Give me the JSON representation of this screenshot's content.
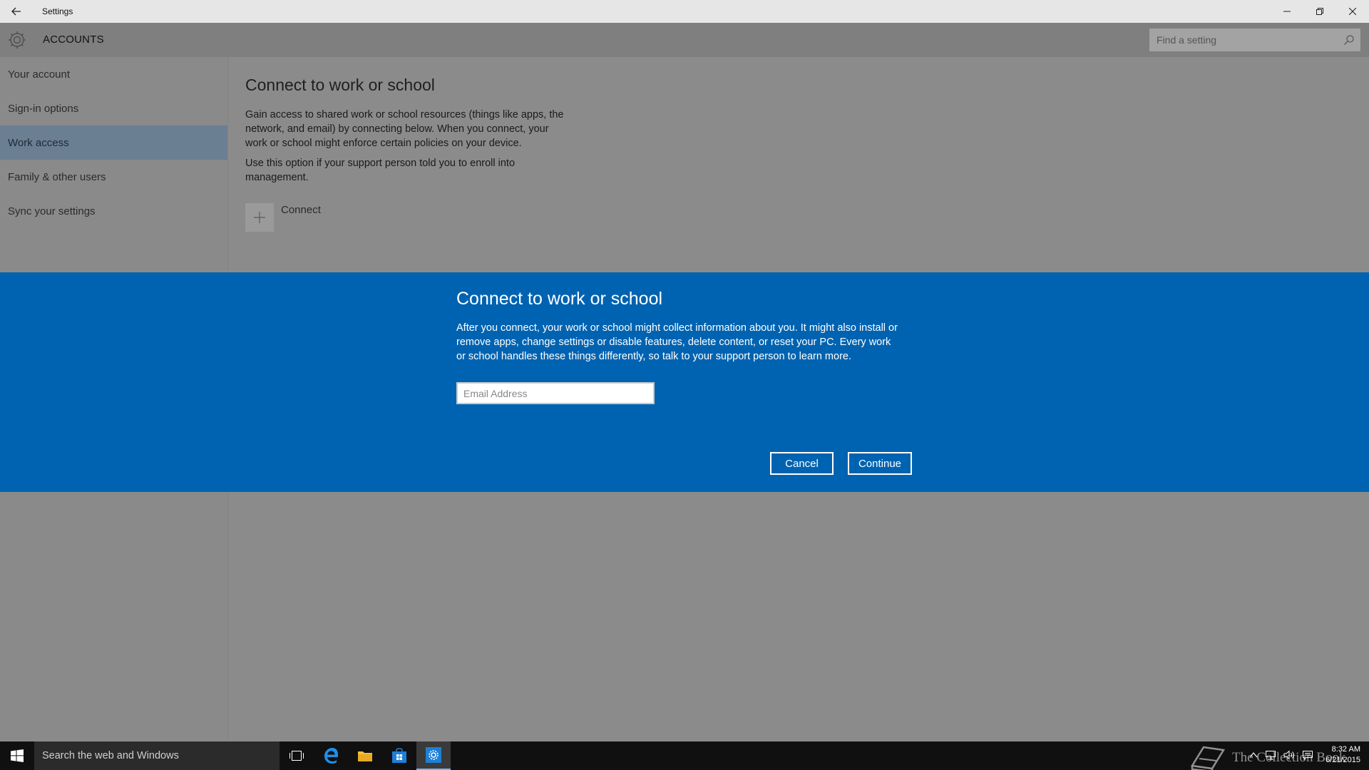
{
  "window": {
    "title": "Settings",
    "minimize_label": "Minimize",
    "restore_label": "Restore",
    "close_label": "Close"
  },
  "header": {
    "section": "ACCOUNTS",
    "search_placeholder": "Find a setting"
  },
  "sidebar": {
    "items": [
      {
        "label": "Your account"
      },
      {
        "label": "Sign-in options"
      },
      {
        "label": "Work access",
        "active": true
      },
      {
        "label": "Family & other users"
      },
      {
        "label": "Sync your settings"
      }
    ]
  },
  "content": {
    "title": "Connect to work or school",
    "paragraph1": "Gain access to shared work or school resources (things like apps, the network, and email) by connecting below. When you connect, your work or school might enforce certain policies on your device.",
    "paragraph2": "Use this option if your support person told you to enroll into management.",
    "connect_label": "Connect"
  },
  "modal": {
    "title": "Connect to work or school",
    "body": "After you connect, your work or school might collect information about you. It might also install or remove apps, change settings or disable features, delete content, or reset your PC. Every work or school handles these things differently, so talk to your support person to learn more.",
    "email_placeholder": "Email Address",
    "email_value": "",
    "cancel_label": "Cancel",
    "continue_label": "Continue"
  },
  "taskbar": {
    "search_text": "Search the web and Windows",
    "watermark": "The Collection Book",
    "time": "8:32 AM",
    "date": "6/21/2015"
  },
  "colors": {
    "accent": "#0063b1",
    "active_nav": "#6b7f92",
    "taskbar": "#101010"
  }
}
